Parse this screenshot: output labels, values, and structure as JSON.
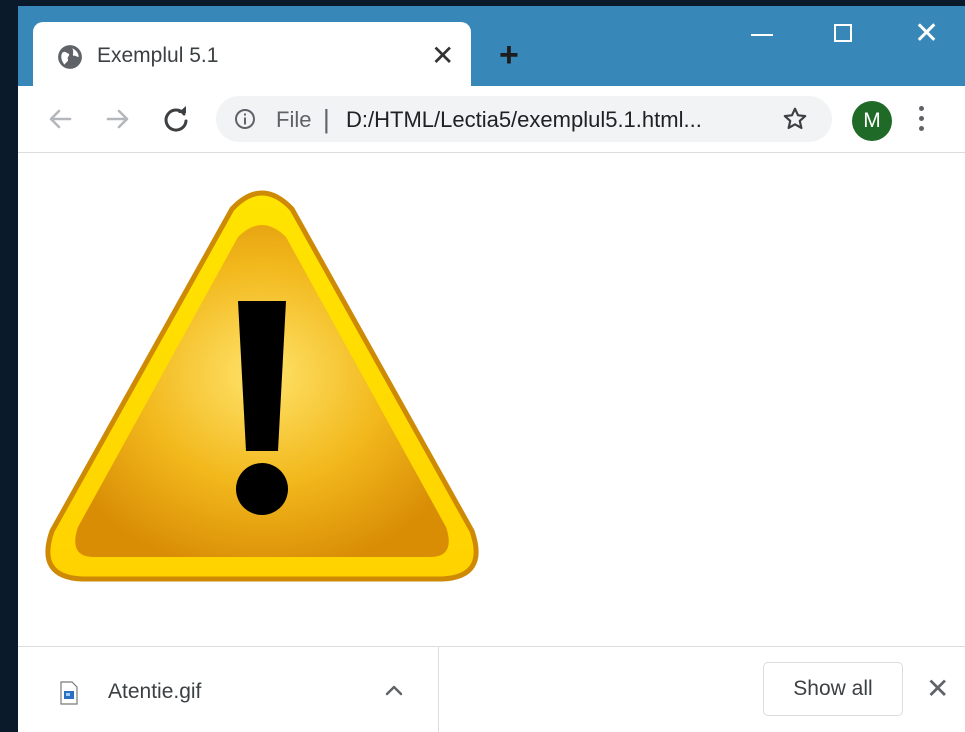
{
  "tab": {
    "title": "Exemplul 5.1",
    "favicon": "globe-icon",
    "close_label": "✕"
  },
  "titlebar": {
    "new_tab_label": "+",
    "color": "#3787b8"
  },
  "window_controls": {
    "close_label": "✕"
  },
  "omnibox": {
    "scheme_label": "File",
    "separator": "|",
    "url": "D:/HTML/Lectia5/exemplul5.1.html..."
  },
  "profile": {
    "initial": "M",
    "color": "#1e6a26"
  },
  "content": {
    "image": "warning-triangle-exclamation",
    "image_colors": [
      "#f9d71c",
      "#e6a40a",
      "#000000"
    ]
  },
  "download_bar": {
    "file_name": "Atentie.gif",
    "file_icon": "image-file-icon",
    "show_all_label": "Show all",
    "close_label": "✕"
  }
}
